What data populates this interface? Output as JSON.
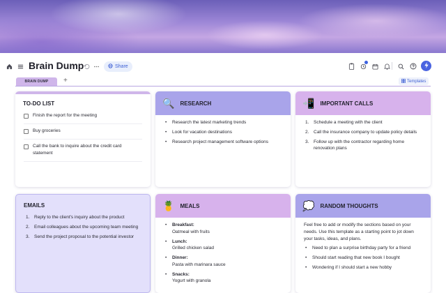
{
  "header": {
    "title": "Brain Dump",
    "share_label": "Share",
    "avatar_initial": "",
    "icons": [
      "home-icon",
      "menu-icon",
      "undo-icon",
      "more-icon",
      "share-icon",
      "clipboard-icon",
      "sync-icon",
      "calendar-icon",
      "bell-icon",
      "search-icon",
      "help-icon"
    ]
  },
  "tabs": {
    "active": "BRAIN DUMP",
    "add": "+",
    "templates_label": "Templates"
  },
  "todo": {
    "title": "TO-DO LIST",
    "items": [
      "Finish the report for the meeting",
      "Buy groceries",
      "Call the bank to inquire about the credit card statement"
    ]
  },
  "research": {
    "title": "RESEARCH",
    "icon": "magnifier-emoji",
    "items": [
      "Research the latest marketing trends",
      "Look for vacation destinations",
      "Research project management software options"
    ]
  },
  "calls": {
    "title": "IMPORTANT CALLS",
    "icon": "phone-emoji",
    "items": [
      "Schedule a meeting with the client",
      "Call the insurance company to update policy details",
      "Follow up with the contractor regarding home renovation plans"
    ]
  },
  "emails": {
    "title": "EMAILS",
    "items": [
      "Reply to the client's inquiry about the product",
      "Email colleagues about the upcoming team meeting",
      "Send the project proposal to the potential investor"
    ]
  },
  "meals": {
    "title": "MEALS",
    "icon": "pineapple-emoji",
    "items": [
      {
        "label": "Breakfast:",
        "value": "Oatmeal with fruits"
      },
      {
        "label": "Lunch:",
        "value": "Grilled chicken salad"
      },
      {
        "label": "Dinner:",
        "value": "Pasta with marinara sauce"
      },
      {
        "label": "Snacks:",
        "value": "Yogurt with granola"
      }
    ]
  },
  "thoughts": {
    "title": "RANDOM THOUGHTS",
    "icon": "thought-bubble-emoji",
    "intro": "Feel free to add or modify the sections based on your needs. Use this template as a starting point to jot down your tasks, ideas, and plans.",
    "items": [
      "Need to plan a surprise birthday party for a friend",
      "Should start reading that new book I bought",
      "Wondering if I should start a new hobby"
    ]
  },
  "colors": {
    "accent": "#4a63e0",
    "tab": "#cfb6ea",
    "lavender": "#a9a4ea",
    "orchid": "#d7b2ec",
    "emails_bg": "#e3e0fb"
  }
}
